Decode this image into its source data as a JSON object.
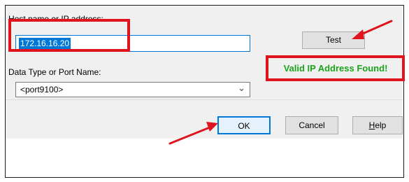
{
  "host": {
    "label": "Host name or IP address:",
    "value": "172.16.16.20"
  },
  "data_type": {
    "label": "Data Type or Port Name:",
    "selected": "<port9100>"
  },
  "buttons": {
    "test": "Test",
    "ok": "OK",
    "cancel": "Cancel",
    "help_mnemonic": "H",
    "help_rest": "elp"
  },
  "status": {
    "message": "Valid IP Address Found!",
    "color": "#1aa51a"
  },
  "annotations": {
    "highlight_color": "#e0141e",
    "icons": [
      "chevron-down-icon",
      "red-arrow-annotation"
    ]
  }
}
